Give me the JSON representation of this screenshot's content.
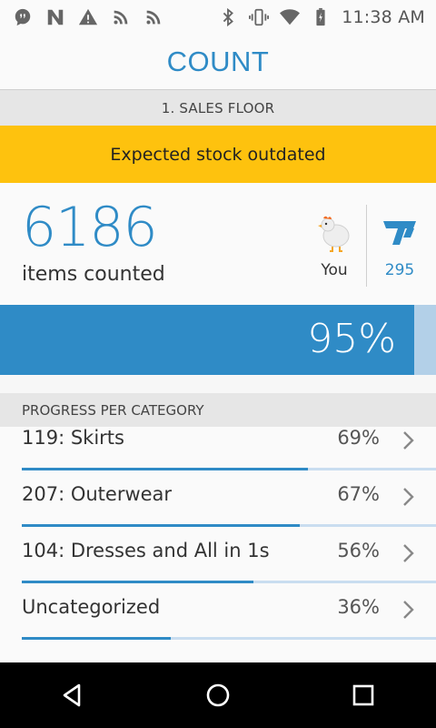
{
  "status_bar": {
    "time": "11:38 AM",
    "left_icons": [
      "chat-bubble-icon",
      "n-logo-icon",
      "warning-icon",
      "rss-icon",
      "rss-icon"
    ],
    "right_icons": [
      "bluetooth-icon",
      "vibrate-icon",
      "wifi-icon",
      "battery-icon"
    ]
  },
  "header": {
    "title": "COUNT"
  },
  "section": {
    "label": "1. SALES FLOOR"
  },
  "banner": {
    "text": "Expected stock outdated",
    "color": "#fec20e"
  },
  "summary": {
    "count": "6186",
    "count_label": "items counted",
    "you_label": "You",
    "team_count": "295"
  },
  "total": {
    "percent_label": "95%",
    "fraction": 0.95
  },
  "categories": {
    "header": "PROGRESS PER CATEGORY",
    "items": [
      {
        "name": "119: Skirts",
        "percent": "69%",
        "fraction": 0.69
      },
      {
        "name": "207: Outerwear",
        "percent": "67%",
        "fraction": 0.67
      },
      {
        "name": "104: Dresses and All in 1s",
        "percent": "56%",
        "fraction": 0.56
      },
      {
        "name": "Uncategorized",
        "percent": "36%",
        "fraction": 0.36
      }
    ]
  },
  "colors": {
    "accent": "#2f8bc6",
    "track": "#c9ddf0"
  },
  "nav_bar": [
    "back-icon",
    "home-icon",
    "recents-icon"
  ]
}
